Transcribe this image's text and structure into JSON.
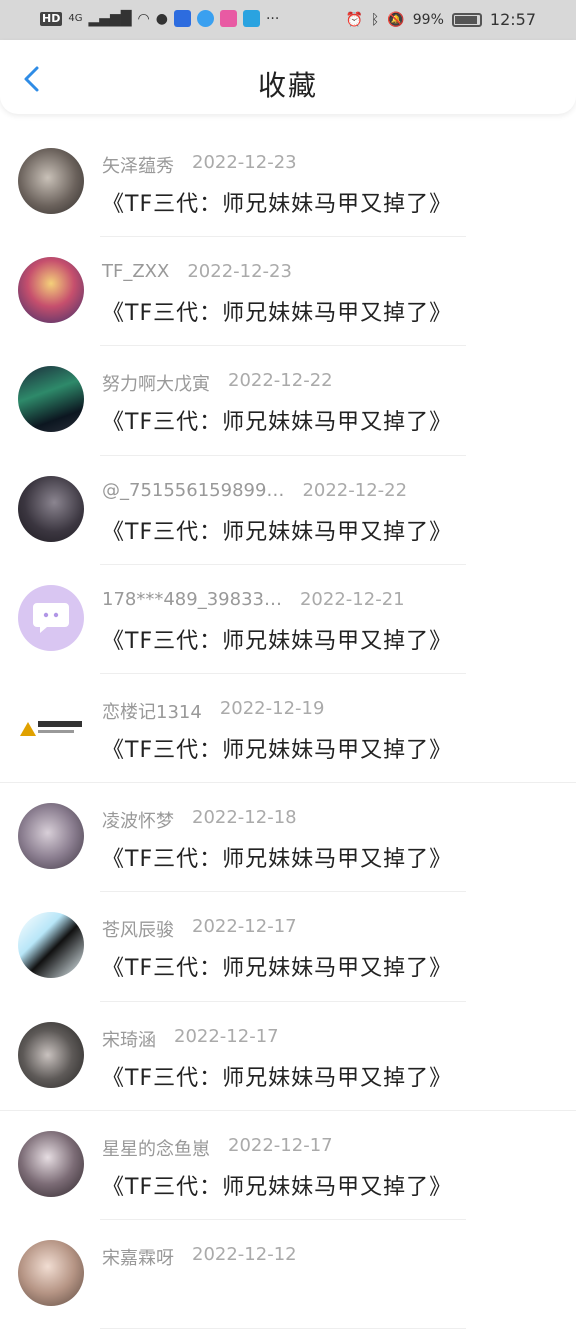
{
  "status_bar": {
    "network": "HD",
    "signal": "4G",
    "battery": "99%",
    "time": "12:57"
  },
  "header": {
    "title": "收藏"
  },
  "favorites": [
    {
      "user": "矢泽蕴秀",
      "date": "2022-12-23",
      "work": "《TF三代：师兄妹妹马甲又掉了》"
    },
    {
      "user": "TF_ZXX",
      "date": "2022-12-23",
      "work": "《TF三代：师兄妹妹马甲又掉了》"
    },
    {
      "user": "努力啊大戊寅",
      "date": "2022-12-22",
      "work": "《TF三代：师兄妹妹马甲又掉了》"
    },
    {
      "user": "@_751556159899…",
      "date": "2022-12-22",
      "work": "《TF三代：师兄妹妹马甲又掉了》"
    },
    {
      "user": "178***489_39833…",
      "date": "2022-12-21",
      "work": "《TF三代：师兄妹妹马甲又掉了》"
    },
    {
      "user": "恋楼记1314",
      "date": "2022-12-19",
      "work": "《TF三代：师兄妹妹马甲又掉了》"
    },
    {
      "user": "凌波怀梦",
      "date": "2022-12-18",
      "work": "《TF三代：师兄妹妹马甲又掉了》"
    },
    {
      "user": "苍风辰骏",
      "date": "2022-12-17",
      "work": "《TF三代：师兄妹妹马甲又掉了》"
    },
    {
      "user": "宋琦涵",
      "date": "2022-12-17",
      "work": "《TF三代：师兄妹妹马甲又掉了》"
    },
    {
      "user": "星星的念鱼崽",
      "date": "2022-12-17",
      "work": "《TF三代：师兄妹妹马甲又掉了》"
    },
    {
      "user": "宋嘉霖呀",
      "date": "2022-12-12",
      "work": ""
    }
  ],
  "colors": {
    "accent": "#2f8ce6",
    "muted_text": "#999999",
    "main_text": "#222222"
  }
}
